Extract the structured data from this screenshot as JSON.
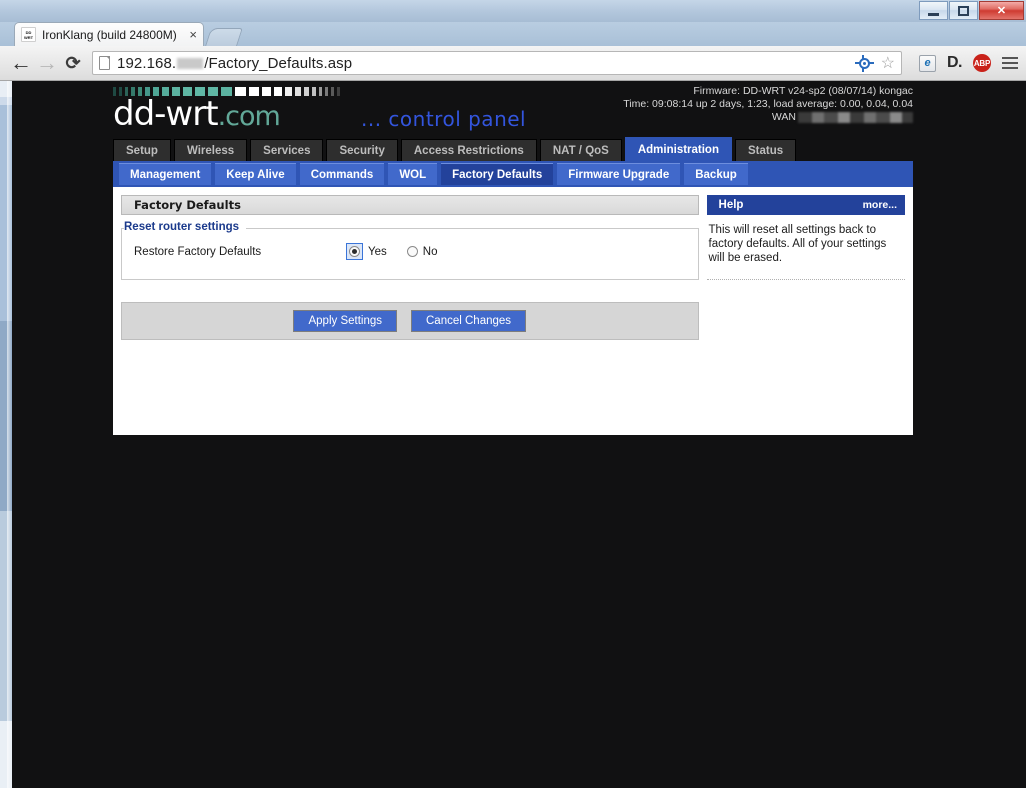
{
  "browser": {
    "tab_title": "IronKlang (build 24800M)",
    "tab_close": "×",
    "favicon_line1": "DD",
    "favicon_line2": "WRT",
    "back_icon": "←",
    "forward_icon": "→",
    "reload_icon": "⟳",
    "url_prefix": "192.168.",
    "url_suffix": "/Factory_Defaults.asp",
    "star_icon": "☆",
    "ie_icon": "e",
    "d_icon": "D.",
    "abp_icon": "ABP",
    "window_minimize": "minimize",
    "window_maximize": "maximize",
    "window_close": "✕"
  },
  "brand": {
    "logo_main": "dd-wrt",
    "logo_tld": ".com",
    "control_panel": "... control panel",
    "bars": [
      {
        "w": 3,
        "c": "#1f4a43"
      },
      {
        "w": 3,
        "c": "#1f4a43"
      },
      {
        "w": 3,
        "c": "#2c6358"
      },
      {
        "w": 4,
        "c": "#357a6b"
      },
      {
        "w": 4,
        "c": "#3e8a78"
      },
      {
        "w": 5,
        "c": "#45988a"
      },
      {
        "w": 6,
        "c": "#4fa696"
      },
      {
        "w": 7,
        "c": "#56ad9c"
      },
      {
        "w": 8,
        "c": "#5cb3a1"
      },
      {
        "w": 9,
        "c": "#5fb6a4"
      },
      {
        "w": 10,
        "c": "#60b8a6"
      },
      {
        "w": 10,
        "c": "#5fb6a4"
      },
      {
        "w": 11,
        "c": "#5cb3a1"
      },
      {
        "w": 11,
        "c": "#ffffff"
      },
      {
        "w": 10,
        "c": "#ffffff"
      },
      {
        "w": 9,
        "c": "#ffffff"
      },
      {
        "w": 8,
        "c": "#ffffff"
      },
      {
        "w": 7,
        "c": "#f0f0f0"
      },
      {
        "w": 6,
        "c": "#e0e0e0"
      },
      {
        "w": 5,
        "c": "#d0d0d0"
      },
      {
        "w": 4,
        "c": "#c0c0c0"
      },
      {
        "w": 3,
        "c": "#9a9a9a"
      },
      {
        "w": 3,
        "c": "#7a7a7a"
      },
      {
        "w": 3,
        "c": "#5a5a5a"
      },
      {
        "w": 3,
        "c": "#3f3f3f"
      }
    ]
  },
  "sysinfo": {
    "firmware": "Firmware: DD-WRT v24-sp2 (08/07/14) kongac",
    "time": "Time: 09:08:14 up 2 days,  1:23, load average: 0.00, 0.04, 0.04",
    "wan_label": "WAN"
  },
  "main_tabs": [
    {
      "label": "Setup",
      "active": false
    },
    {
      "label": "Wireless",
      "active": false
    },
    {
      "label": "Services",
      "active": false
    },
    {
      "label": "Security",
      "active": false
    },
    {
      "label": "Access Restrictions",
      "active": false
    },
    {
      "label": "NAT / QoS",
      "active": false
    },
    {
      "label": "Administration",
      "active": true
    },
    {
      "label": "Status",
      "active": false
    }
  ],
  "sub_tabs": [
    {
      "label": "Management",
      "active": false
    },
    {
      "label": "Keep Alive",
      "active": false
    },
    {
      "label": "Commands",
      "active": false
    },
    {
      "label": "WOL",
      "active": false
    },
    {
      "label": "Factory Defaults",
      "active": true
    },
    {
      "label": "Firmware Upgrade",
      "active": false
    },
    {
      "label": "Backup",
      "active": false
    }
  ],
  "page": {
    "section_title": "Factory Defaults",
    "legend": "Reset router settings",
    "field_label": "Restore Factory Defaults",
    "radio_yes": "Yes",
    "radio_no": "No",
    "selected": "Yes",
    "apply_label": "Apply Settings",
    "cancel_label": "Cancel Changes"
  },
  "help": {
    "title": "Help",
    "more": "more...",
    "text": "This will reset all settings back to factory defaults. All of your settings will be erased."
  },
  "colors": {
    "accent_blue": "#2f55b5",
    "subtab_blue": "#4169cb",
    "active_subtab_blue": "#23429b",
    "logo_teal": "#62a898",
    "control_panel_blue": "#3355dd"
  }
}
